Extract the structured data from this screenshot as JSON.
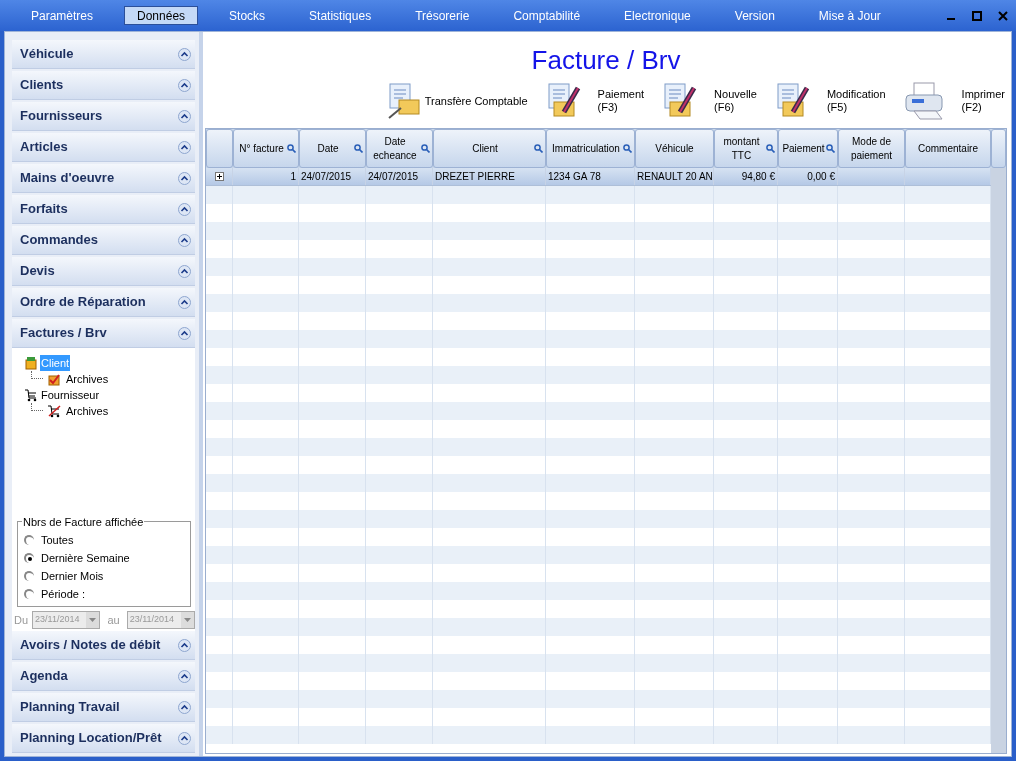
{
  "menu": [
    {
      "label": "Paramètres",
      "selected": false
    },
    {
      "label": "Données",
      "selected": true
    },
    {
      "label": "Stocks",
      "selected": false
    },
    {
      "label": "Statistiques",
      "selected": false
    },
    {
      "label": "Trésorerie",
      "selected": false
    },
    {
      "label": "Comptabilité",
      "selected": false
    },
    {
      "label": "Electronique",
      "selected": false
    },
    {
      "label": "Version",
      "selected": false
    },
    {
      "label": "Mise à Jour",
      "selected": false
    }
  ],
  "sidebar": {
    "sections": [
      {
        "label": "Véhicule"
      },
      {
        "label": "Clients"
      },
      {
        "label": "Fournisseurs"
      },
      {
        "label": "Articles"
      },
      {
        "label": "Mains d'oeuvre"
      },
      {
        "label": "Forfaits"
      },
      {
        "label": "Commandes"
      },
      {
        "label": "Devis"
      },
      {
        "label": "Ordre de Réparation"
      },
      {
        "label": "Factures / Brv",
        "tree": [
          {
            "label": "Client",
            "selected": true,
            "children": [
              {
                "label": "Archives",
                "selected": false
              }
            ]
          },
          {
            "label": "Fournisseur",
            "selected": false,
            "children": [
              {
                "label": "Archives",
                "selected": false
              }
            ]
          }
        ],
        "filter": {
          "title": "Nbrs de Facture affichée",
          "options": [
            {
              "label": "Toutes",
              "selected": false
            },
            {
              "label": "Dernière Semaine",
              "selected": true
            },
            {
              "label": "Dernier Mois",
              "selected": false
            },
            {
              "label": "Période :",
              "selected": false
            }
          ],
          "from_label": "Du",
          "from": {
            "value": "23/11/2014",
            "disabled": true
          },
          "to_label": "au",
          "to": {
            "value": "23/11/2014",
            "disabled": true
          }
        }
      },
      {
        "label": "Avoirs / Notes de débit"
      },
      {
        "label": "Agenda"
      },
      {
        "label": "Planning Travail"
      },
      {
        "label": "Planning Location/Prêt"
      }
    ]
  },
  "title": "Facture / Brv",
  "toolbar": [
    {
      "label": "Transfère Comptable"
    },
    {
      "label": "Paiement",
      "shortcut": "(F3)"
    },
    {
      "label": "Nouvelle",
      "shortcut": "(F6)"
    },
    {
      "label": "Modification",
      "shortcut": "(F5)"
    },
    {
      "label": "Imprimer",
      "shortcut": "(F2)"
    }
  ],
  "table": {
    "columns": [
      {
        "label": "N° facture",
        "search": true
      },
      {
        "label": "Date",
        "search": true
      },
      {
        "label": "Date echeance",
        "search": true
      },
      {
        "label": "Client",
        "search": true
      },
      {
        "label": "Immatriculation",
        "search": true
      },
      {
        "label": "Véhicule",
        "search": false
      },
      {
        "label": "montant TTC",
        "search": true
      },
      {
        "label": "Paiement",
        "search": true
      },
      {
        "label": "Mode de paiement",
        "search": false
      },
      {
        "label": "Commentaire",
        "search": false
      }
    ],
    "rows": [
      {
        "selected": true,
        "cells": [
          "1",
          "24/07/2015",
          "24/07/2015",
          "DREZET PIERRE",
          "1234 GA 78",
          "RENAULT 20 AN",
          "94,80 €",
          "0,00 €",
          "",
          ""
        ]
      }
    ]
  }
}
